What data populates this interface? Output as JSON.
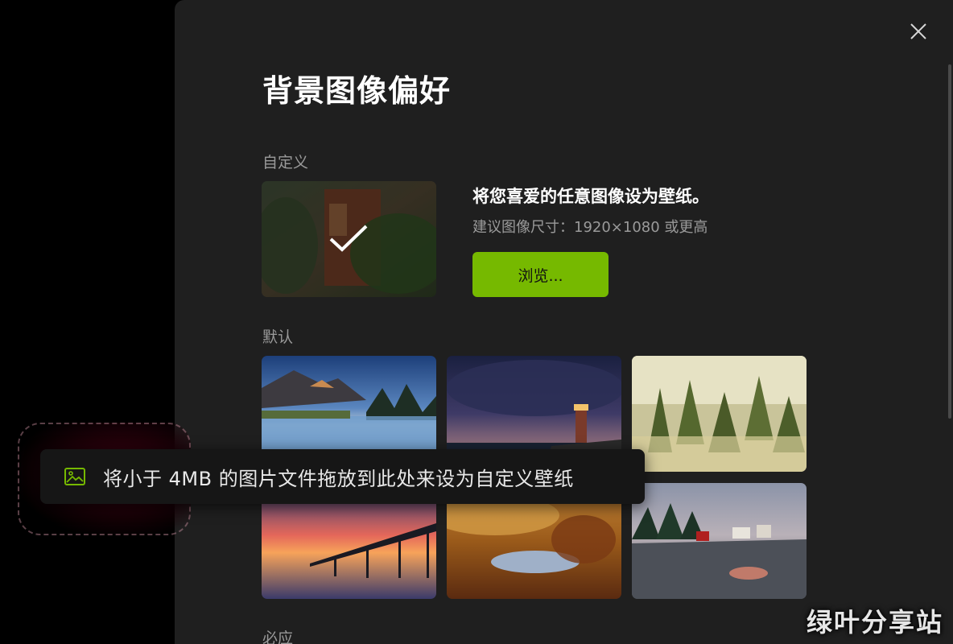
{
  "dialog": {
    "title": "背景图像偏好",
    "close_icon": "close-icon"
  },
  "custom": {
    "section_label": "自定义",
    "description": "将您喜爱的任意图像设为壁纸。",
    "hint": "建议图像尺寸：1920×1080 或更高",
    "browse_label": "浏览...",
    "selected": true
  },
  "default": {
    "section_label": "默认",
    "wallpapers": [
      "mountain-lake",
      "lighthouse-night",
      "misty-forest",
      "pier-sunset",
      "autumn-valley-pond",
      "rocky-coast-village"
    ]
  },
  "next_section": {
    "label": "必应"
  },
  "toast": {
    "icon": "image-icon",
    "text": "将小于 4MB 的图片文件拖放到此处来设为自定义壁纸"
  },
  "watermark": "绿叶分享站",
  "colors": {
    "accent": "#76b900",
    "panel_bg": "#1f1f1f",
    "toast_icon": "#76b900"
  }
}
